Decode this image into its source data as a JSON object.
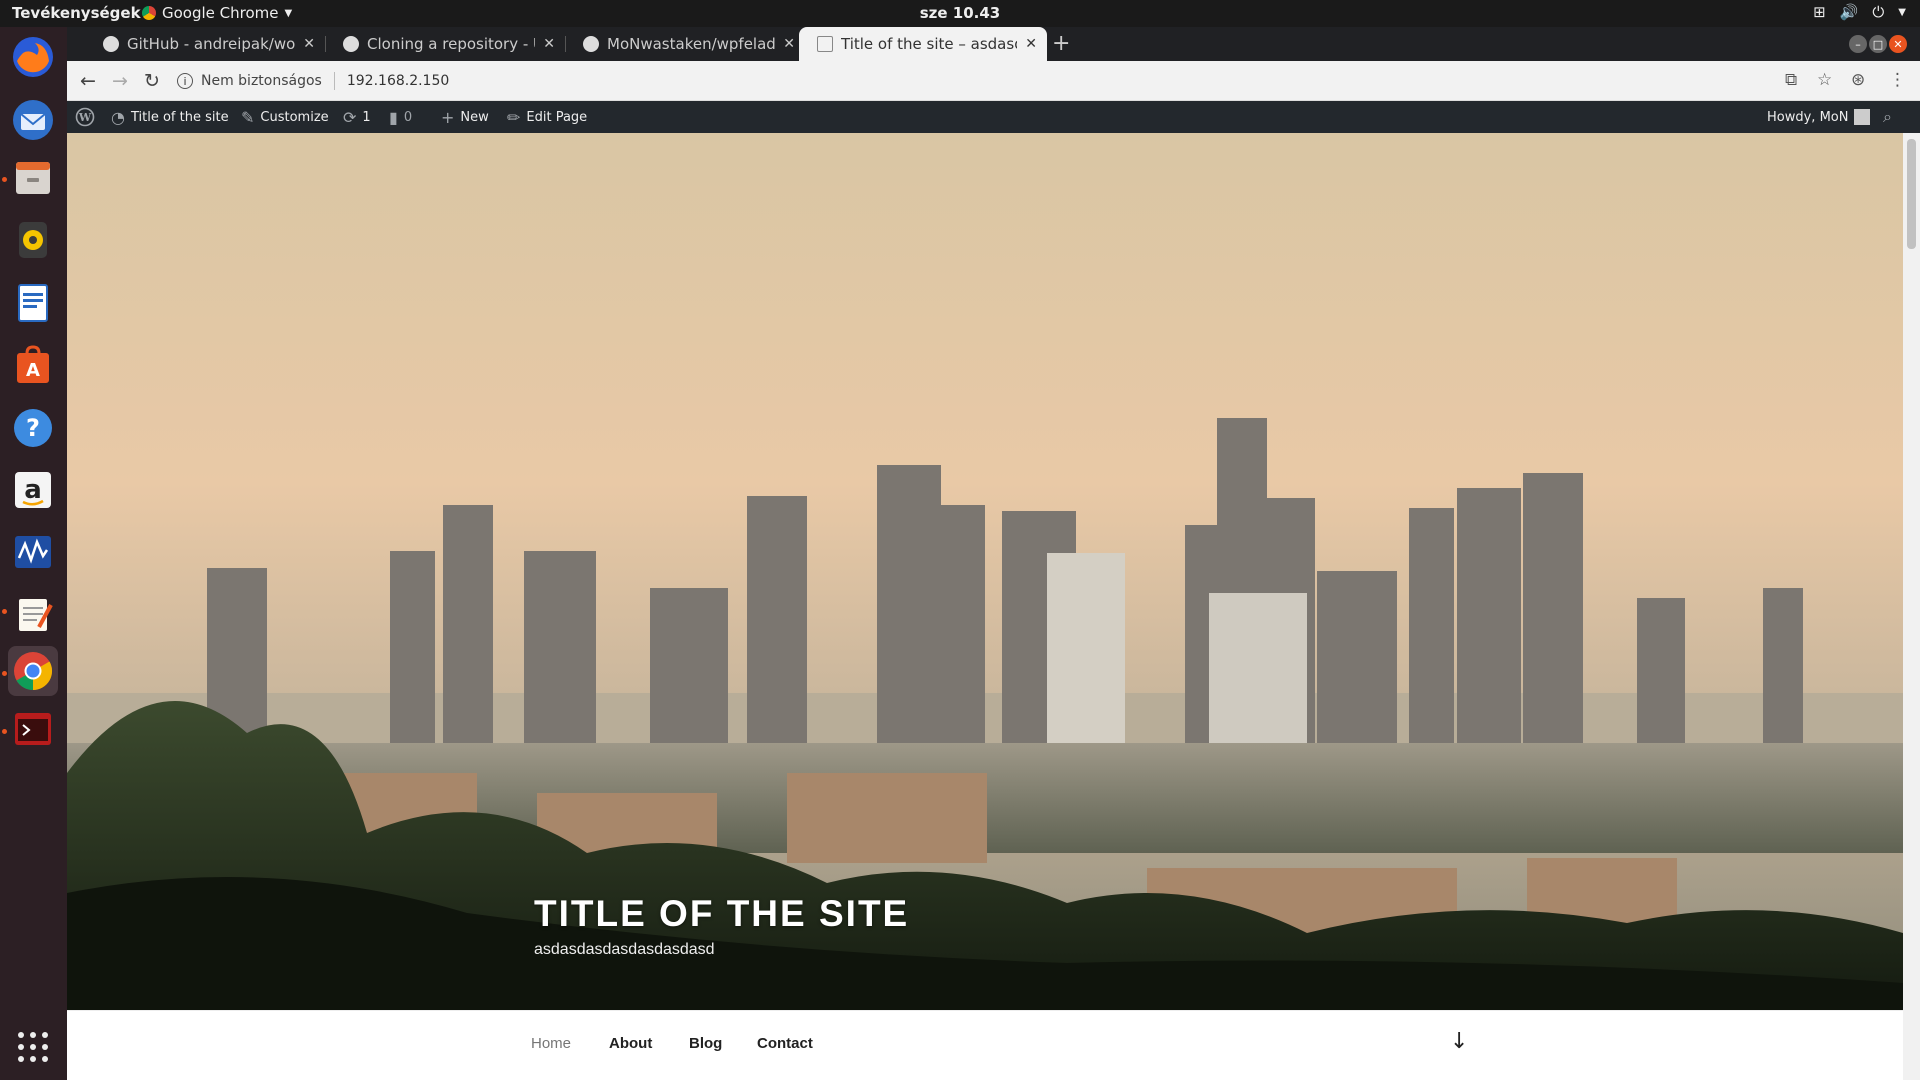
{
  "topbar": {
    "activities": "Tevékenységek",
    "app_name": "Google Chrome",
    "clock": "sze 10.43"
  },
  "dock": {
    "apps": [
      "firefox-icon",
      "thunderbird-icon",
      "files-icon",
      "rhythmbox-icon",
      "writer-icon",
      "software-icon",
      "help-icon",
      "amazon-icon",
      "monitor-icon",
      "text-editor-icon",
      "chrome-icon",
      "terminal-icon"
    ]
  },
  "tabs": [
    {
      "title": "GitHub - andreipak/word"
    },
    {
      "title": "Cloning a repository - Use"
    },
    {
      "title": "MoNwastaken/wpfeladat"
    },
    {
      "title": "Title of the site – asdasda"
    }
  ],
  "address": {
    "security": "Nem biztonságos",
    "url": "192.168.2.150"
  },
  "wpbar": {
    "site_name": "Title of the site",
    "customize": "Customize",
    "updates": "1",
    "comments": "0",
    "new": "New",
    "edit": "Edit Page",
    "howdy": "Howdy, MoN"
  },
  "site": {
    "title": "TITLE OF THE SITE",
    "description": "asdasdasdasdasdasdasd"
  },
  "nav": {
    "items": [
      "Home",
      "About",
      "Blog",
      "Contact"
    ]
  },
  "colors": {
    "ubuntu_orange": "#e95420",
    "wp_admin_bar": "#23282d",
    "dock_bg": "#2c1f24"
  }
}
